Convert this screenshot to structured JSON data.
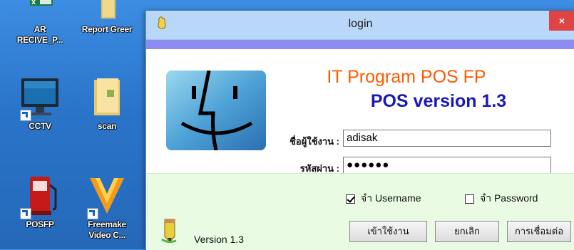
{
  "desktop": {
    "icons": [
      {
        "label": "AR\nRECIVE_P...",
        "icon": "excel-icon"
      },
      {
        "label": "Report Greer",
        "icon": "folder-icon"
      },
      {
        "label": "CCTV",
        "icon": "monitor-icon"
      },
      {
        "label": "scan",
        "icon": "folder-icon"
      },
      {
        "label": "POSFP",
        "icon": "fuel-pump-icon"
      },
      {
        "label": "Freemake\nVideo C...",
        "icon": "freemake-icon"
      }
    ]
  },
  "window": {
    "title": "login",
    "close": "×",
    "heading1": "IT Program POS FP",
    "heading2": "POS version 1.3",
    "username_label": "ชื่อผู้ใช้งาน :",
    "username_value": "adisak",
    "password_label": "รหัสผ่าน :",
    "password_mask": "●●●●●●",
    "remember_user_label": "จำ Username",
    "remember_user_checked": true,
    "remember_pass_label": "จำ Password",
    "remember_pass_checked": false,
    "version_text": "Version 1.3",
    "buttons": {
      "login": "เข้าใช้งาน",
      "cancel": "ยกเลิก",
      "connect": "การเชื่อมต่อ"
    }
  },
  "colors": {
    "heading1": "#ff5a00",
    "heading2": "#1a19b8",
    "titlebar": "#b9d7f8",
    "strip": "#8d8cf3",
    "bottom": "#e9fbe3",
    "close": "#e04343"
  }
}
